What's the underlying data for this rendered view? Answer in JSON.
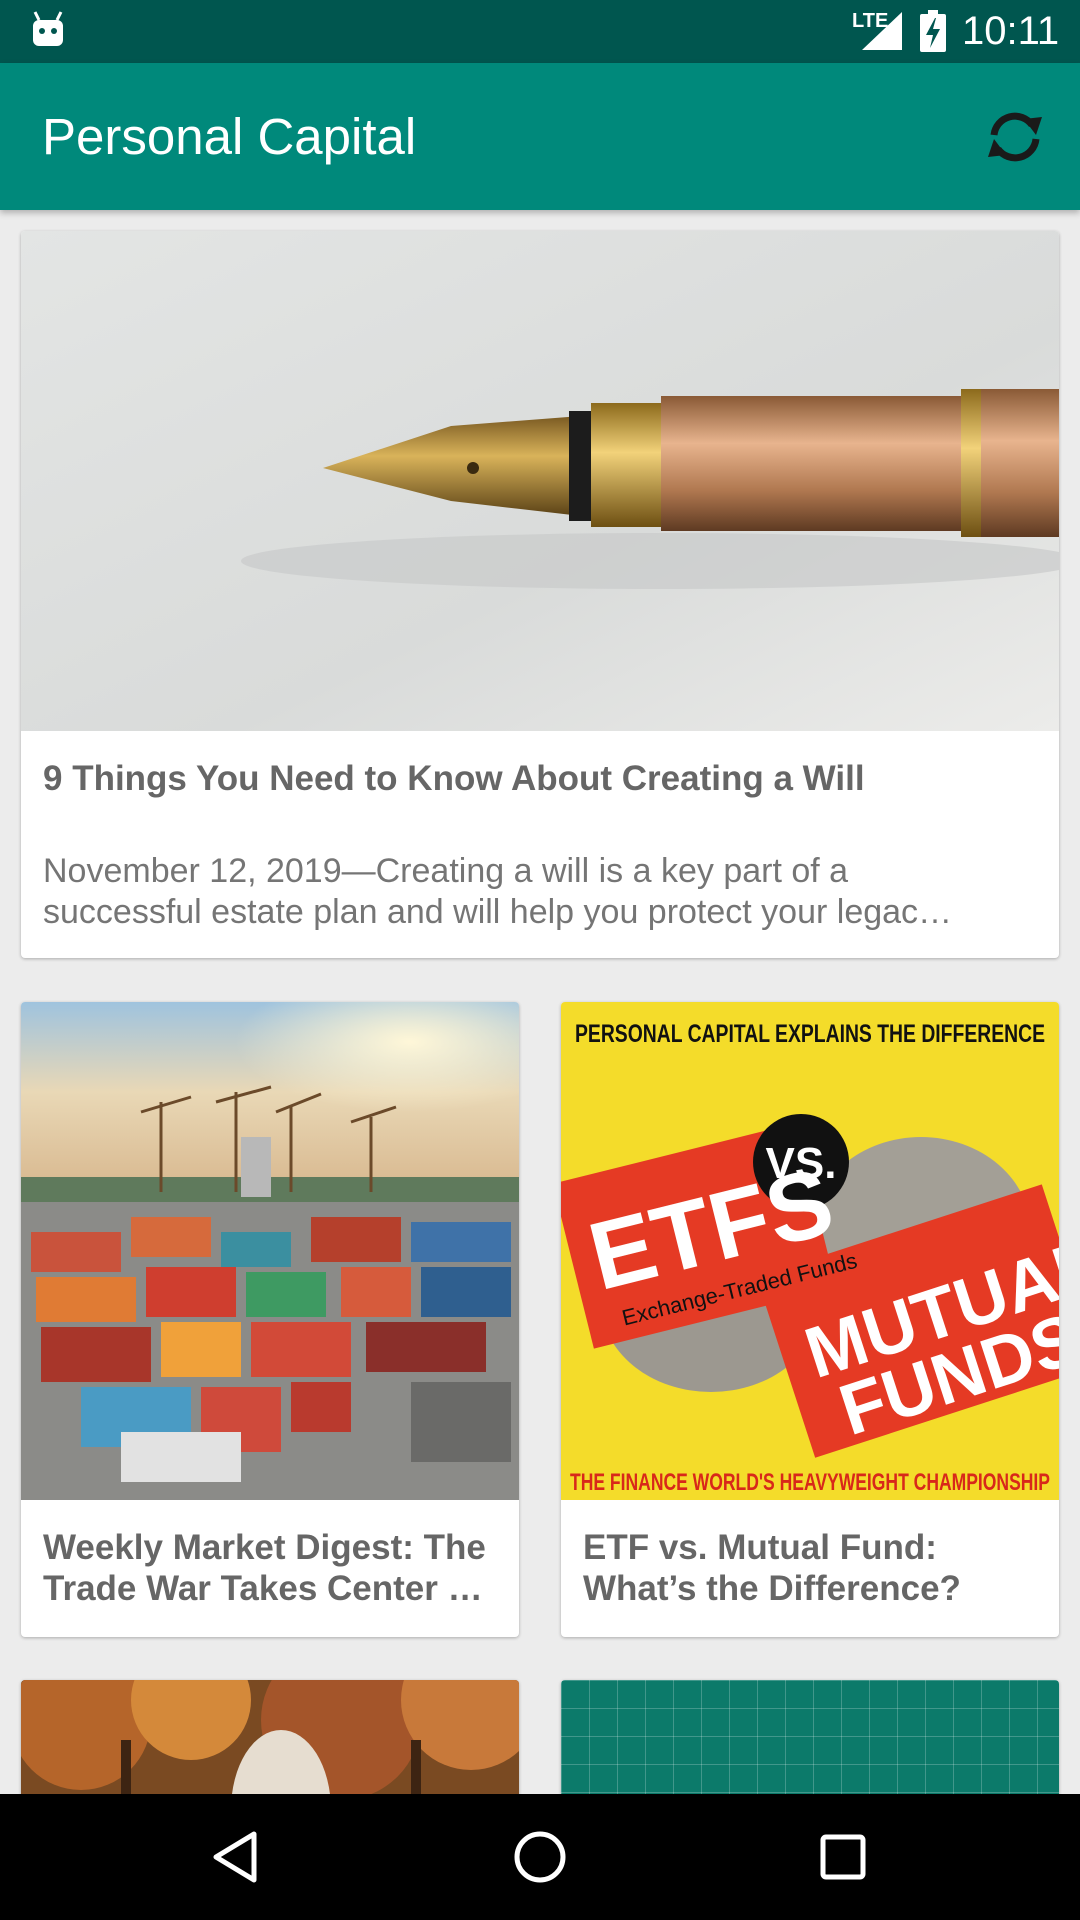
{
  "status_bar": {
    "network": "LTE",
    "time": "10:11",
    "icons": [
      "android-icon",
      "signal-icon",
      "battery-charging-icon"
    ]
  },
  "app_bar": {
    "title": "Personal Capital",
    "refresh_icon": "refresh-icon"
  },
  "articles": [
    {
      "title": "9 Things You Need to Know About Creating a Will",
      "snippet_line1": "November 12, 2019—Creating a will is a key part of a",
      "snippet_line2": "successful estate plan and will help you protect your legac…",
      "image": "fountain-pen-image"
    },
    {
      "title_line1": "Weekly Market Digest: The",
      "title_line2": "Trade War Takes Center …",
      "image": "shipping-containers-image"
    },
    {
      "title_line1": "ETF vs. Mutual Fund:",
      "title_line2": "What’s the Difference?",
      "image": "etf-vs-mutual-funds-image",
      "image_text": {
        "top": "PERSONAL CAPITAL EXPLAINS THE DIFFERENCE",
        "left": "ETFS",
        "left_sub": "Exchange-Traded Funds",
        "vs": "VS.",
        "right_1": "MUTUAL",
        "right_2": "FUNDS",
        "bottom": "THE FINANCE WORLD'S HEAVYWEIGHT CHAMPIONSHIP"
      }
    },
    {
      "image": "autumn-trees-image"
    },
    {
      "image": "teal-grid-image"
    }
  ],
  "colors": {
    "status_bar": "#00564f",
    "app_bar": "#00897b",
    "background": "#ececec",
    "etf_yellow": "#f4dc2a",
    "etf_red": "#e53a24"
  },
  "nav_bar": {
    "buttons": [
      "back-icon",
      "home-icon",
      "recents-icon"
    ]
  }
}
